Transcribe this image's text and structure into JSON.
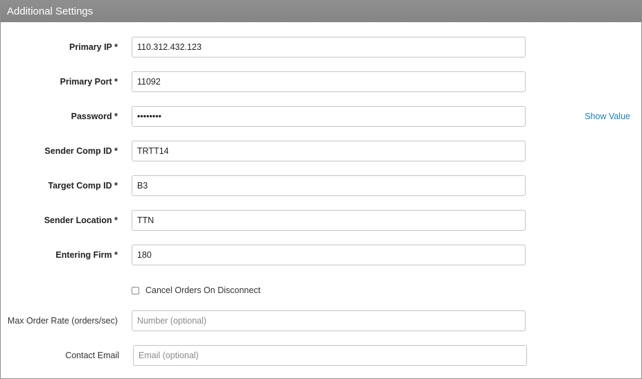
{
  "header": {
    "title": "Additional Settings"
  },
  "fields": {
    "primary_ip": {
      "label": "Primary IP *",
      "value": "110.312.432.123"
    },
    "primary_port": {
      "label": "Primary Port *",
      "value": "11092"
    },
    "password": {
      "label": "Password *",
      "value": "••••••••",
      "show_value_label": "Show Value"
    },
    "sender_comp_id": {
      "label": "Sender Comp ID *",
      "value": "TRTT14"
    },
    "target_comp_id": {
      "label": "Target Comp ID *",
      "value": "B3"
    },
    "sender_location": {
      "label": "Sender Location *",
      "value": "TTN"
    },
    "entering_firm": {
      "label": "Entering Firm *",
      "value": "180"
    },
    "cancel_orders": {
      "label": "Cancel Orders On Disconnect",
      "checked": false
    },
    "max_order_rate": {
      "label": "Max Order Rate (orders/sec)",
      "value": "",
      "placeholder": "Number (optional)"
    },
    "contact_email": {
      "label": "Contact Email",
      "value": "",
      "placeholder": "Email (optional)"
    }
  },
  "colors": {
    "header_bg": "#888888",
    "link": "#1a7fc1",
    "input_border": "#c4c4c4"
  }
}
